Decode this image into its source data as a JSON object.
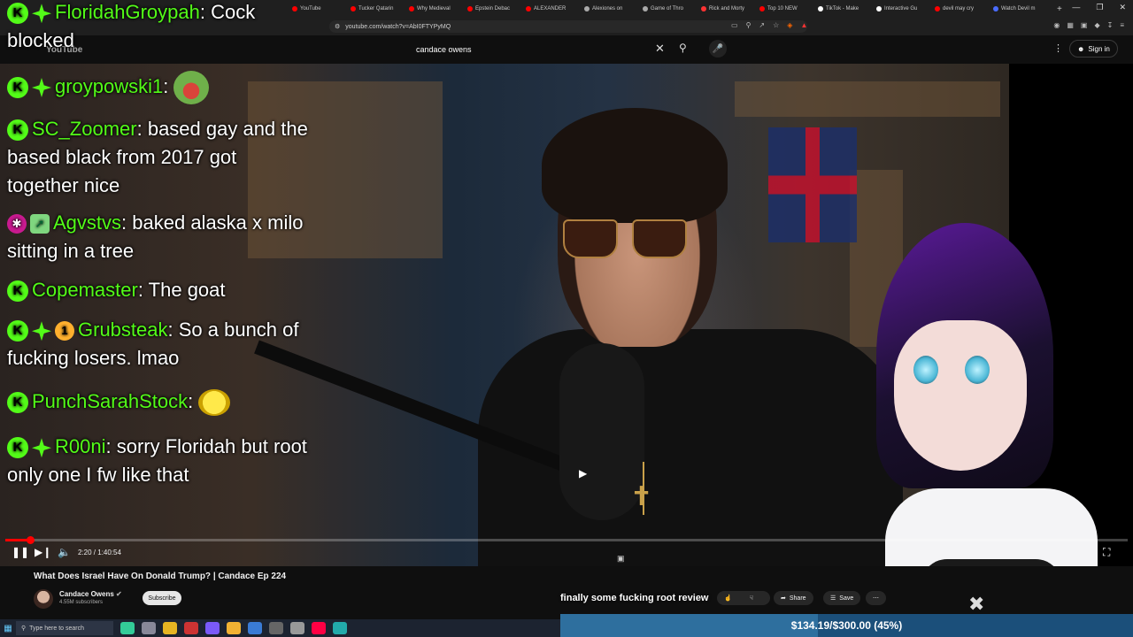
{
  "browser": {
    "tabs": [
      {
        "label": "YouTube",
        "color": "#ff0000"
      },
      {
        "label": "Tucker Qatarin",
        "color": "#ff0000"
      },
      {
        "label": "Why Medieval",
        "color": "#ff0000"
      },
      {
        "label": "Epstein Debac",
        "color": "#ff0000"
      },
      {
        "label": "ALEXANDER",
        "color": "#ff0000"
      },
      {
        "label": "Alexiones on",
        "color": "#aaaaaa"
      },
      {
        "label": "Game of Thro",
        "color": "#aaaaaa"
      },
      {
        "label": "Rick and Morty",
        "color": "#ff3333"
      },
      {
        "label": "Top 10 NEW",
        "color": "#ff0000"
      },
      {
        "label": "TikTok - Make",
        "color": "#ffffff"
      },
      {
        "label": "Interactive Gu",
        "color": "#ffffff"
      },
      {
        "label": "devil may cry",
        "color": "#ff0000"
      },
      {
        "label": "Watch Devil m",
        "color": "#4a6cff"
      }
    ],
    "url": "youtube.com/watch?v=AbI0FTYPyMQ"
  },
  "youtube": {
    "logo": "YouTube",
    "search_value": "candace owens",
    "signin_label": "Sign in"
  },
  "chat": {
    "messages": [
      {
        "user": "FloridahGroypah",
        "text": "Cock blocked",
        "badges": [
          "kick",
          "diamond"
        ]
      },
      {
        "user": "groypowski1",
        "text": "",
        "badges": [
          "kick",
          "diamond"
        ],
        "emote": "pepe-scream"
      },
      {
        "user": "SC_Zoomer",
        "text": "based gay and the based black from 2017 got together nice",
        "badges": [
          "kick"
        ]
      },
      {
        "user": "Agvstvs",
        "text": "baked alaska x milo sitting in a tree",
        "badges": [
          "og",
          "chart"
        ]
      },
      {
        "user": "Copemaster",
        "text": "The goat",
        "badges": [
          "kick"
        ]
      },
      {
        "user": "Grubsteak",
        "text": "So a bunch of fucking losers. lmao",
        "badges": [
          "kick",
          "diamond",
          "sub"
        ]
      },
      {
        "user": "PunchSarahStock",
        "text": "",
        "badges": [
          "kick"
        ],
        "emote": "face"
      },
      {
        "user": "R00ni",
        "text": "sorry Floridah but root only one I fw like that",
        "badges": [
          "kick",
          "diamond"
        ]
      }
    ],
    "sub_badge_number": "1"
  },
  "player": {
    "progress_fraction": 0.022,
    "time_display": "2:20 / 1:40:54"
  },
  "video": {
    "title": "What Does Israel Have On Donald Trump? | Candace Ep 224",
    "channel": "Candace Owens",
    "subscribers": "4.55M subscribers",
    "subscribe_label": "Subscribe",
    "share_label": "Share",
    "save_label": "Save"
  },
  "overlay": {
    "tts_text": "finally some fucking root review",
    "donation_text": "$134.19/$300.00 (45%)",
    "donation_fraction": 0.45
  },
  "taskbar": {
    "search_placeholder": "Type here to search"
  },
  "colors": {
    "kick_green": "#53fc18",
    "youtube_red": "#ff0000",
    "donation_bar": "#1b4f7a"
  }
}
